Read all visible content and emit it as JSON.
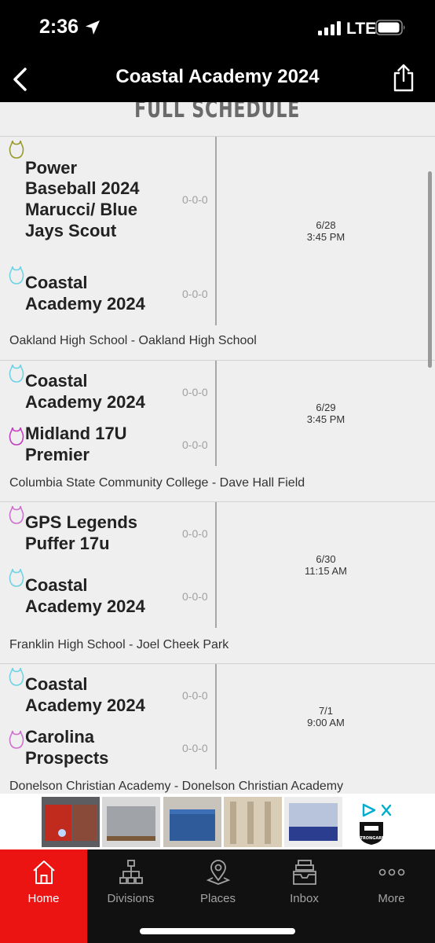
{
  "status": {
    "time": "2:36",
    "network": "LTE"
  },
  "nav": {
    "title": "Coastal Academy 2024"
  },
  "section": {
    "header": "FULL SCHEDULE"
  },
  "games": [
    {
      "teams": [
        {
          "name": "Power Baseball 2024 Marucci/ Blue Jays Scout",
          "record": "0-0-0",
          "icon_color": "#9a9a2c"
        },
        {
          "name": "Coastal Academy 2024",
          "record": "0-0-0",
          "icon_color": "#6fd3e6"
        }
      ],
      "date": "6/28",
      "time": "3:45 PM",
      "venue": "Oakland High School - Oakland High School"
    },
    {
      "teams": [
        {
          "name": "Coastal Academy 2024",
          "record": "0-0-0",
          "icon_color": "#6fd3e6"
        },
        {
          "name": "Midland 17U Premier",
          "record": "0-0-0",
          "icon_color": "#c23fc2"
        }
      ],
      "date": "6/29",
      "time": "3:45 PM",
      "venue": "Columbia State Community College - Dave Hall Field"
    },
    {
      "teams": [
        {
          "name": "GPS Legends Puffer 17u",
          "record": "0-0-0",
          "icon_color": "#d070d0"
        },
        {
          "name": "Coastal Academy 2024",
          "record": "0-0-0",
          "icon_color": "#6fd3e6"
        }
      ],
      "date": "6/30",
      "time": "11:15 AM",
      "venue": "Franklin High School - Joel Cheek Park"
    },
    {
      "teams": [
        {
          "name": "Coastal Academy 2024",
          "record": "0-0-0",
          "icon_color": "#6fd3e6"
        },
        {
          "name": "Carolina Prospects",
          "record": "0-0-0",
          "icon_color": "#d070d0"
        }
      ],
      "date": "7/1",
      "time": "9:00 AM",
      "venue": "Donelson Christian Academy - Donelson Christian Academy"
    }
  ],
  "ad": {
    "logo_text": "STRONGARM"
  },
  "tabs": [
    {
      "label": "Home",
      "icon": "home-icon",
      "active": true
    },
    {
      "label": "Divisions",
      "icon": "divisions-icon",
      "active": false
    },
    {
      "label": "Places",
      "icon": "map-pin-icon",
      "active": false
    },
    {
      "label": "Inbox",
      "icon": "inbox-icon",
      "active": false
    },
    {
      "label": "More",
      "icon": "more-icon",
      "active": false
    }
  ],
  "colors": {
    "accent": "#ec1313",
    "header_bg": "#000000",
    "content_bg": "#efefef"
  }
}
